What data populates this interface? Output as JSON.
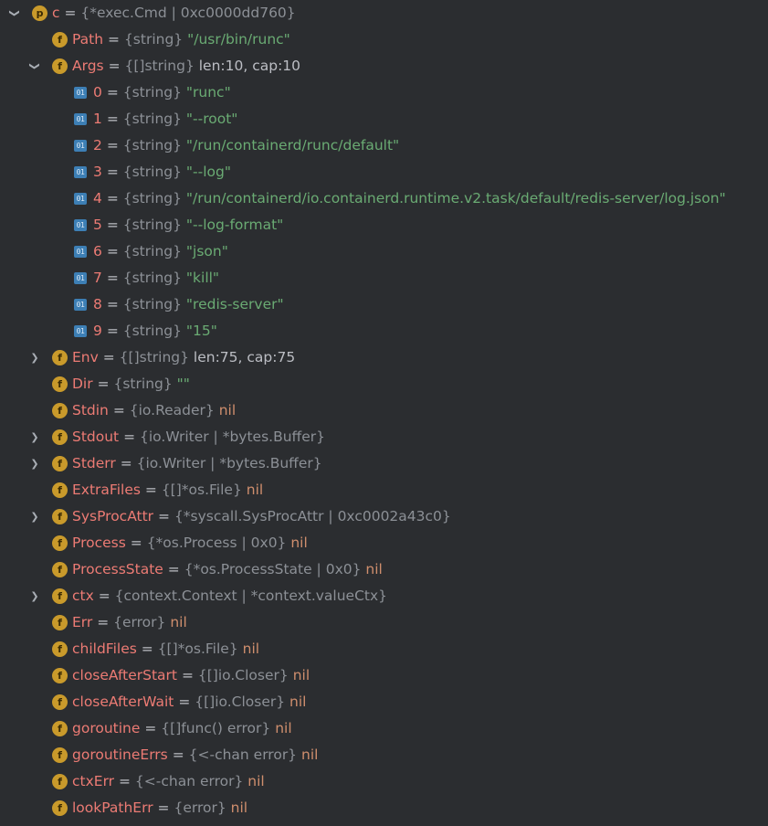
{
  "tree": [
    {
      "id": "c",
      "level": 0,
      "expander": "expanded",
      "icon": "param",
      "name": "c",
      "type": "{*exec.Cmd | 0xc0000dd760}",
      "value": "",
      "vclass": "plain"
    },
    {
      "id": "path",
      "level": 1,
      "expander": "none",
      "icon": "field",
      "name": "Path",
      "type": "{string}",
      "value": "\"/usr/bin/runc\"",
      "vclass": "str"
    },
    {
      "id": "args",
      "level": 1,
      "expander": "expanded",
      "icon": "field",
      "name": "Args",
      "type": "{[]string}",
      "value": "len:10, cap:10",
      "vclass": "plain"
    },
    {
      "id": "args-0",
      "level": 2,
      "expander": "none",
      "icon": "elem",
      "name": "0",
      "type": "{string}",
      "value": "\"runc\"",
      "vclass": "str"
    },
    {
      "id": "args-1",
      "level": 2,
      "expander": "none",
      "icon": "elem",
      "name": "1",
      "type": "{string}",
      "value": "\"--root\"",
      "vclass": "str"
    },
    {
      "id": "args-2",
      "level": 2,
      "expander": "none",
      "icon": "elem",
      "name": "2",
      "type": "{string}",
      "value": "\"/run/containerd/runc/default\"",
      "vclass": "str"
    },
    {
      "id": "args-3",
      "level": 2,
      "expander": "none",
      "icon": "elem",
      "name": "3",
      "type": "{string}",
      "value": "\"--log\"",
      "vclass": "str"
    },
    {
      "id": "args-4",
      "level": 2,
      "expander": "none",
      "icon": "elem",
      "name": "4",
      "type": "{string}",
      "value": "\"/run/containerd/io.containerd.runtime.v2.task/default/redis-server/log.json\"",
      "vclass": "str"
    },
    {
      "id": "args-5",
      "level": 2,
      "expander": "none",
      "icon": "elem",
      "name": "5",
      "type": "{string}",
      "value": "\"--log-format\"",
      "vclass": "str"
    },
    {
      "id": "args-6",
      "level": 2,
      "expander": "none",
      "icon": "elem",
      "name": "6",
      "type": "{string}",
      "value": "\"json\"",
      "vclass": "str"
    },
    {
      "id": "args-7",
      "level": 2,
      "expander": "none",
      "icon": "elem",
      "name": "7",
      "type": "{string}",
      "value": "\"kill\"",
      "vclass": "str"
    },
    {
      "id": "args-8",
      "level": 2,
      "expander": "none",
      "icon": "elem",
      "name": "8",
      "type": "{string}",
      "value": "\"redis-server\"",
      "vclass": "str"
    },
    {
      "id": "args-9",
      "level": 2,
      "expander": "none",
      "icon": "elem",
      "name": "9",
      "type": "{string}",
      "value": "\"15\"",
      "vclass": "str"
    },
    {
      "id": "env",
      "level": 1,
      "expander": "collapsed",
      "icon": "field",
      "name": "Env",
      "type": "{[]string}",
      "value": "len:75, cap:75",
      "vclass": "plain"
    },
    {
      "id": "dir",
      "level": 1,
      "expander": "none",
      "icon": "field",
      "name": "Dir",
      "type": "{string}",
      "value": "\"\"",
      "vclass": "str"
    },
    {
      "id": "stdin",
      "level": 1,
      "expander": "none",
      "icon": "field",
      "name": "Stdin",
      "type": "{io.Reader}",
      "value": "nil",
      "vclass": "nil"
    },
    {
      "id": "stdout",
      "level": 1,
      "expander": "collapsed",
      "icon": "field",
      "name": "Stdout",
      "type": "{io.Writer | *bytes.Buffer}",
      "value": "",
      "vclass": "plain"
    },
    {
      "id": "stderr",
      "level": 1,
      "expander": "collapsed",
      "icon": "field",
      "name": "Stderr",
      "type": "{io.Writer | *bytes.Buffer}",
      "value": "",
      "vclass": "plain"
    },
    {
      "id": "extrafiles",
      "level": 1,
      "expander": "none",
      "icon": "field",
      "name": "ExtraFiles",
      "type": "{[]*os.File}",
      "value": "nil",
      "vclass": "nil"
    },
    {
      "id": "sysprocattr",
      "level": 1,
      "expander": "collapsed",
      "icon": "field",
      "name": "SysProcAttr",
      "type": "{*syscall.SysProcAttr | 0xc0002a43c0}",
      "value": "",
      "vclass": "plain"
    },
    {
      "id": "process",
      "level": 1,
      "expander": "none",
      "icon": "field",
      "name": "Process",
      "type": "{*os.Process | 0x0}",
      "value": "nil",
      "vclass": "nil"
    },
    {
      "id": "processstate",
      "level": 1,
      "expander": "none",
      "icon": "field",
      "name": "ProcessState",
      "type": "{*os.ProcessState | 0x0}",
      "value": "nil",
      "vclass": "nil"
    },
    {
      "id": "ctx",
      "level": 1,
      "expander": "collapsed",
      "icon": "field",
      "name": "ctx",
      "type": "{context.Context | *context.valueCtx}",
      "value": "",
      "vclass": "plain"
    },
    {
      "id": "err",
      "level": 1,
      "expander": "none",
      "icon": "field",
      "name": "Err",
      "type": "{error}",
      "value": "nil",
      "vclass": "nil"
    },
    {
      "id": "childfiles",
      "level": 1,
      "expander": "none",
      "icon": "field",
      "name": "childFiles",
      "type": "{[]*os.File}",
      "value": "nil",
      "vclass": "nil"
    },
    {
      "id": "closeafterstart",
      "level": 1,
      "expander": "none",
      "icon": "field",
      "name": "closeAfterStart",
      "type": "{[]io.Closer}",
      "value": "nil",
      "vclass": "nil"
    },
    {
      "id": "closeafterwait",
      "level": 1,
      "expander": "none",
      "icon": "field",
      "name": "closeAfterWait",
      "type": "{[]io.Closer}",
      "value": "nil",
      "vclass": "nil"
    },
    {
      "id": "goroutine",
      "level": 1,
      "expander": "none",
      "icon": "field",
      "name": "goroutine",
      "type": "{[]func() error}",
      "value": "nil",
      "vclass": "nil"
    },
    {
      "id": "goroutineerrs",
      "level": 1,
      "expander": "none",
      "icon": "field",
      "name": "goroutineErrs",
      "type": "{<-chan error}",
      "value": "nil",
      "vclass": "nil"
    },
    {
      "id": "ctxerr",
      "level": 1,
      "expander": "none",
      "icon": "field",
      "name": "ctxErr",
      "type": "{<-chan error}",
      "value": "nil",
      "vclass": "nil"
    },
    {
      "id": "lookpatherr",
      "level": 1,
      "expander": "none",
      "icon": "field",
      "name": "lookPathErr",
      "type": "{error}",
      "value": "nil",
      "vclass": "nil"
    }
  ],
  "symbols": {
    "equals": "=",
    "expanded": "❯",
    "collapsed": "❯",
    "icon_field": "f",
    "icon_param": "p",
    "icon_elem": "01"
  },
  "colors": {
    "background": "#2b2d30",
    "name": "#ec7b74",
    "type": "#8c9096",
    "string_value": "#6aab73",
    "nil_value": "#cf8e6d",
    "icon_field": "#c99a2b",
    "icon_elem": "#3d7fb5"
  }
}
